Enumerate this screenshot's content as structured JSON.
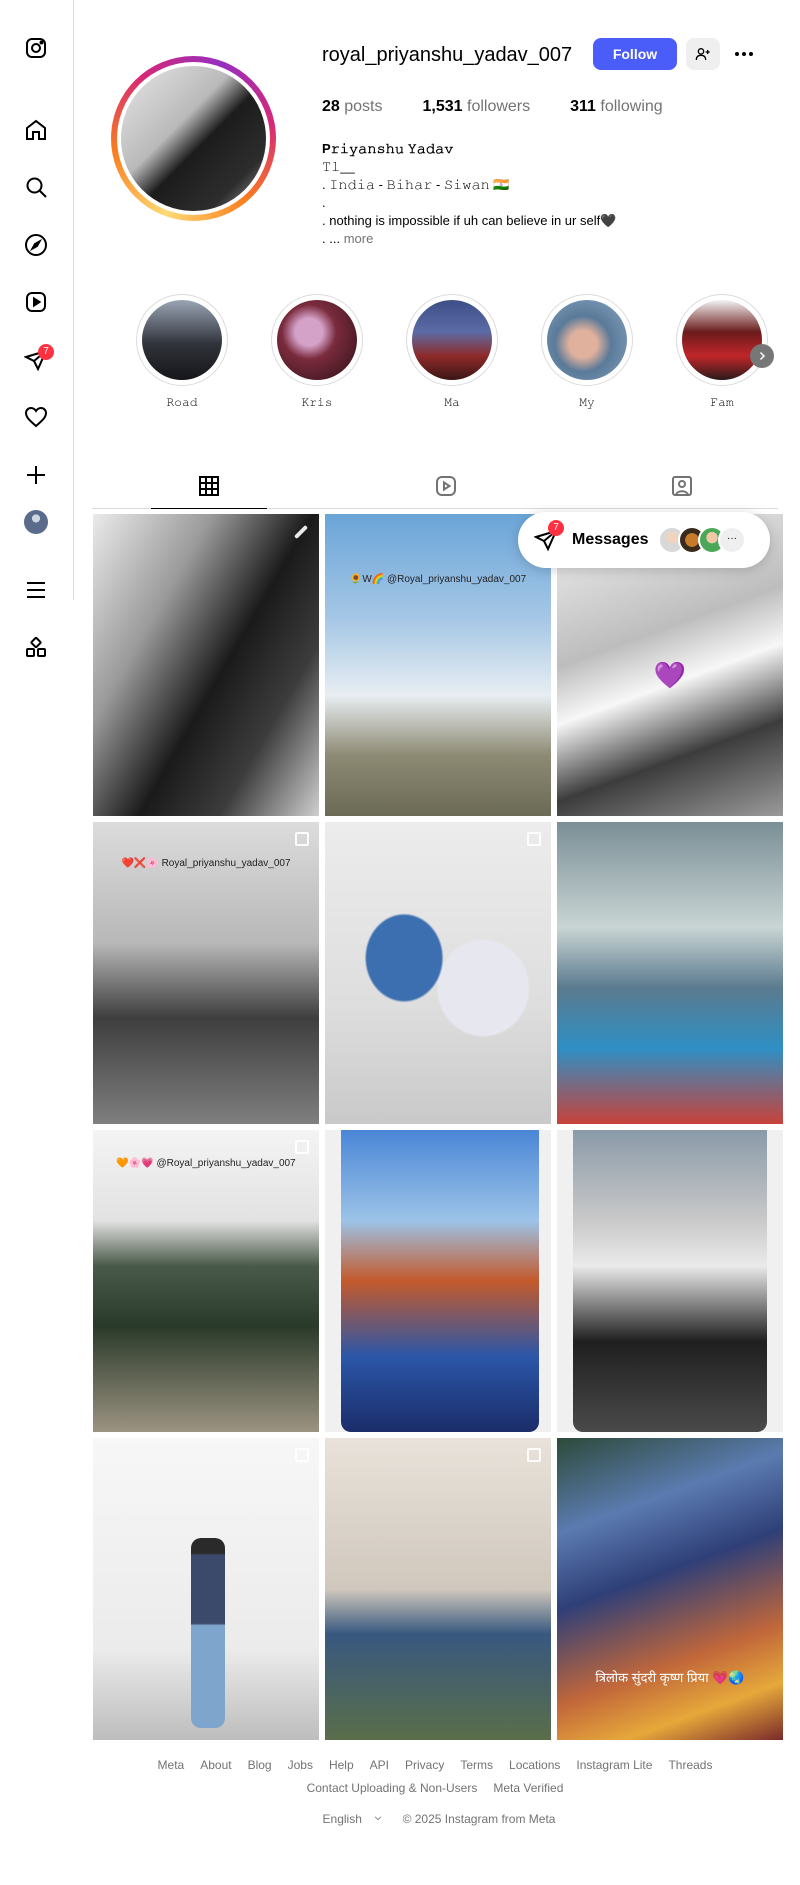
{
  "sidebar": {
    "items": [
      {
        "icon": "instagram-logo-icon"
      },
      {
        "icon": "home-icon"
      },
      {
        "icon": "search-icon"
      },
      {
        "icon": "explore-icon"
      },
      {
        "icon": "reels-icon"
      },
      {
        "icon": "messenger-icon",
        "badge": "7"
      },
      {
        "icon": "heart-icon"
      },
      {
        "icon": "create-icon"
      },
      {
        "icon": "profile-avatar"
      },
      {
        "icon": "menu-icon"
      },
      {
        "icon": "more-apps-icon"
      }
    ],
    "messenger_badge": "7"
  },
  "profile": {
    "username": "royal_priyanshu_yadav_007",
    "follow_label": "Follow",
    "stats": {
      "posts_count": "28",
      "posts_label": "posts",
      "followers_count": "1,531",
      "followers_label": "followers",
      "following_count": "311",
      "following_label": "following"
    },
    "bio": {
      "name": "P𝚛𝚒𝚢𝚊𝚗𝚜𝚑𝚞 𝚈𝚊𝚍𝚊𝚟",
      "line1": "𝚃𝚕__",
      "line2": ". 𝙸𝚗𝚍𝚒𝚊 - 𝙱𝚒𝚑𝚊𝚛 - 𝚂𝚒𝚠𝚊𝚗 🇮🇳",
      "line3": ".",
      "line4": ". nothing is impossible if uh can believe in ur self🖤",
      "line5_prefix": ". ...",
      "more": "more"
    }
  },
  "highlights": [
    {
      "label": "𝚁𝚘𝚊𝚍"
    },
    {
      "label": "𝙺𝚛𝚒𝚜"
    },
    {
      "label": "𝙼𝚊"
    },
    {
      "label": "𝙼𝚢"
    },
    {
      "label": "𝙵𝚊𝚖"
    }
  ],
  "tabs": [
    {
      "icon": "grid-icon",
      "active": true
    },
    {
      "icon": "reels-tab-icon",
      "active": false
    },
    {
      "icon": "tagged-icon",
      "active": false
    }
  ],
  "posts": [
    {
      "overlay": ""
    },
    {
      "overlay": "🌻W🌈 @Royal_priyanshu_yadav_007"
    },
    {
      "overlay": "💜"
    },
    {
      "overlay": "❤️❌🌸 Royal_priyanshu_yadav_007"
    },
    {
      "overlay": ""
    },
    {
      "overlay": ""
    },
    {
      "overlay": "🧡🌸💗 @Royal_priyanshu_yadav_007"
    },
    {
      "overlay": ""
    },
    {
      "overlay": ""
    },
    {
      "overlay": ""
    },
    {
      "overlay": ""
    },
    {
      "overlay": "त्रिलोक सुंदरी कृष्ण प्रिया 💗🌏"
    }
  ],
  "messages": {
    "label": "Messages",
    "badge": "7",
    "more": "···"
  },
  "footer": {
    "links": [
      "Meta",
      "About",
      "Blog",
      "Jobs",
      "Help",
      "API",
      "Privacy",
      "Terms",
      "Locations",
      "Instagram Lite",
      "Threads",
      "Contact Uploading & Non-Users",
      "Meta Verified"
    ],
    "language": "English",
    "copyright": "© 2025 Instagram from Meta"
  },
  "colors": {
    "accent": "#4a5df9",
    "badge": "#ff3040",
    "muted": "#737373",
    "border": "#dbdbdb"
  }
}
